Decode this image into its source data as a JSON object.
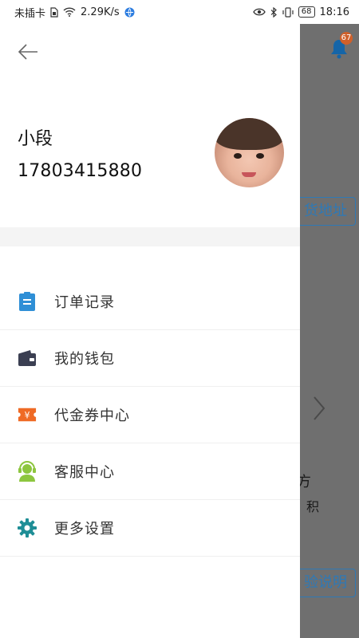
{
  "status_bar": {
    "carrier": "未插卡",
    "speed": "2.29K/s",
    "battery": "68",
    "time": "18:16"
  },
  "background": {
    "badge_count": "67",
    "address_button": "货地址",
    "text_line_1": "方",
    "text_line_2": "积",
    "explain_button": "验说明"
  },
  "drawer": {
    "user": {
      "name": "小段",
      "phone": "17803415880"
    },
    "menu": [
      {
        "label": "订单记录",
        "icon": "clipboard-icon",
        "color": "#2f8fd6"
      },
      {
        "label": "我的钱包",
        "icon": "wallet-icon",
        "color": "#3b3f52"
      },
      {
        "label": "代金券中心",
        "icon": "coupon-icon",
        "color": "#ef6a25"
      },
      {
        "label": "客服中心",
        "icon": "headset-icon",
        "color": "#8dc63f"
      },
      {
        "label": "更多设置",
        "icon": "gear-icon",
        "color": "#1f8e96"
      }
    ]
  }
}
